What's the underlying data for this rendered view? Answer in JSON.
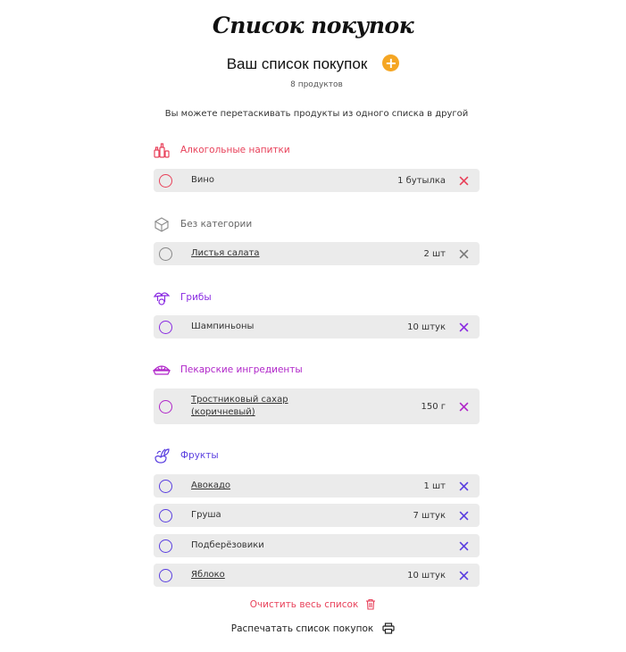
{
  "page": {
    "title": "Список покупок"
  },
  "list": {
    "title": "Ваш список покупок",
    "add_label": "+",
    "count": "8 продуктов",
    "hint": "Вы можете перетаскивать продукты из одного списка в другой"
  },
  "categories": [
    {
      "name": "Алкогольные напитки",
      "icon": "bottles-icon",
      "color": "#e8415a",
      "items": [
        {
          "name": "Вино",
          "qty": "1 бутылка",
          "link": false
        }
      ]
    },
    {
      "name": "Без категории",
      "icon": "box-icon",
      "color": "#8a8a8a",
      "items": [
        {
          "name": "Листья салата",
          "qty": "2 шт",
          "link": true
        }
      ]
    },
    {
      "name": "Грибы",
      "icon": "mushroom-icon",
      "color": "#8a2be2",
      "items": [
        {
          "name": "Шампиньоны",
          "qty": "10 штук",
          "link": false
        }
      ]
    },
    {
      "name": "Пекарские ингредиенты",
      "icon": "pie-icon",
      "color": "#b026c9",
      "items": [
        {
          "name": "Тростниковый сахар (коричневый)",
          "name_line1": "Тростниковый сахар",
          "name_line2": "(коричневый)",
          "qty": "150 г",
          "link": true
        }
      ]
    },
    {
      "name": "Фрукты",
      "icon": "fruit-icon",
      "color": "#5a3fe0",
      "items": [
        {
          "name": "Авокадо",
          "qty": "1 шт",
          "link": true
        },
        {
          "name": "Груша",
          "qty": "7 штук",
          "link": false
        },
        {
          "name": "Подберёзовики",
          "qty": "",
          "link": false
        },
        {
          "name": "Яблоко",
          "qty": "10 штук",
          "link": true
        }
      ]
    }
  ],
  "actions": {
    "clear_label": "Очистить весь список",
    "clear_icon": "trash-icon",
    "print_label": "Распечатать список покупок",
    "print_icon": "printer-icon"
  }
}
